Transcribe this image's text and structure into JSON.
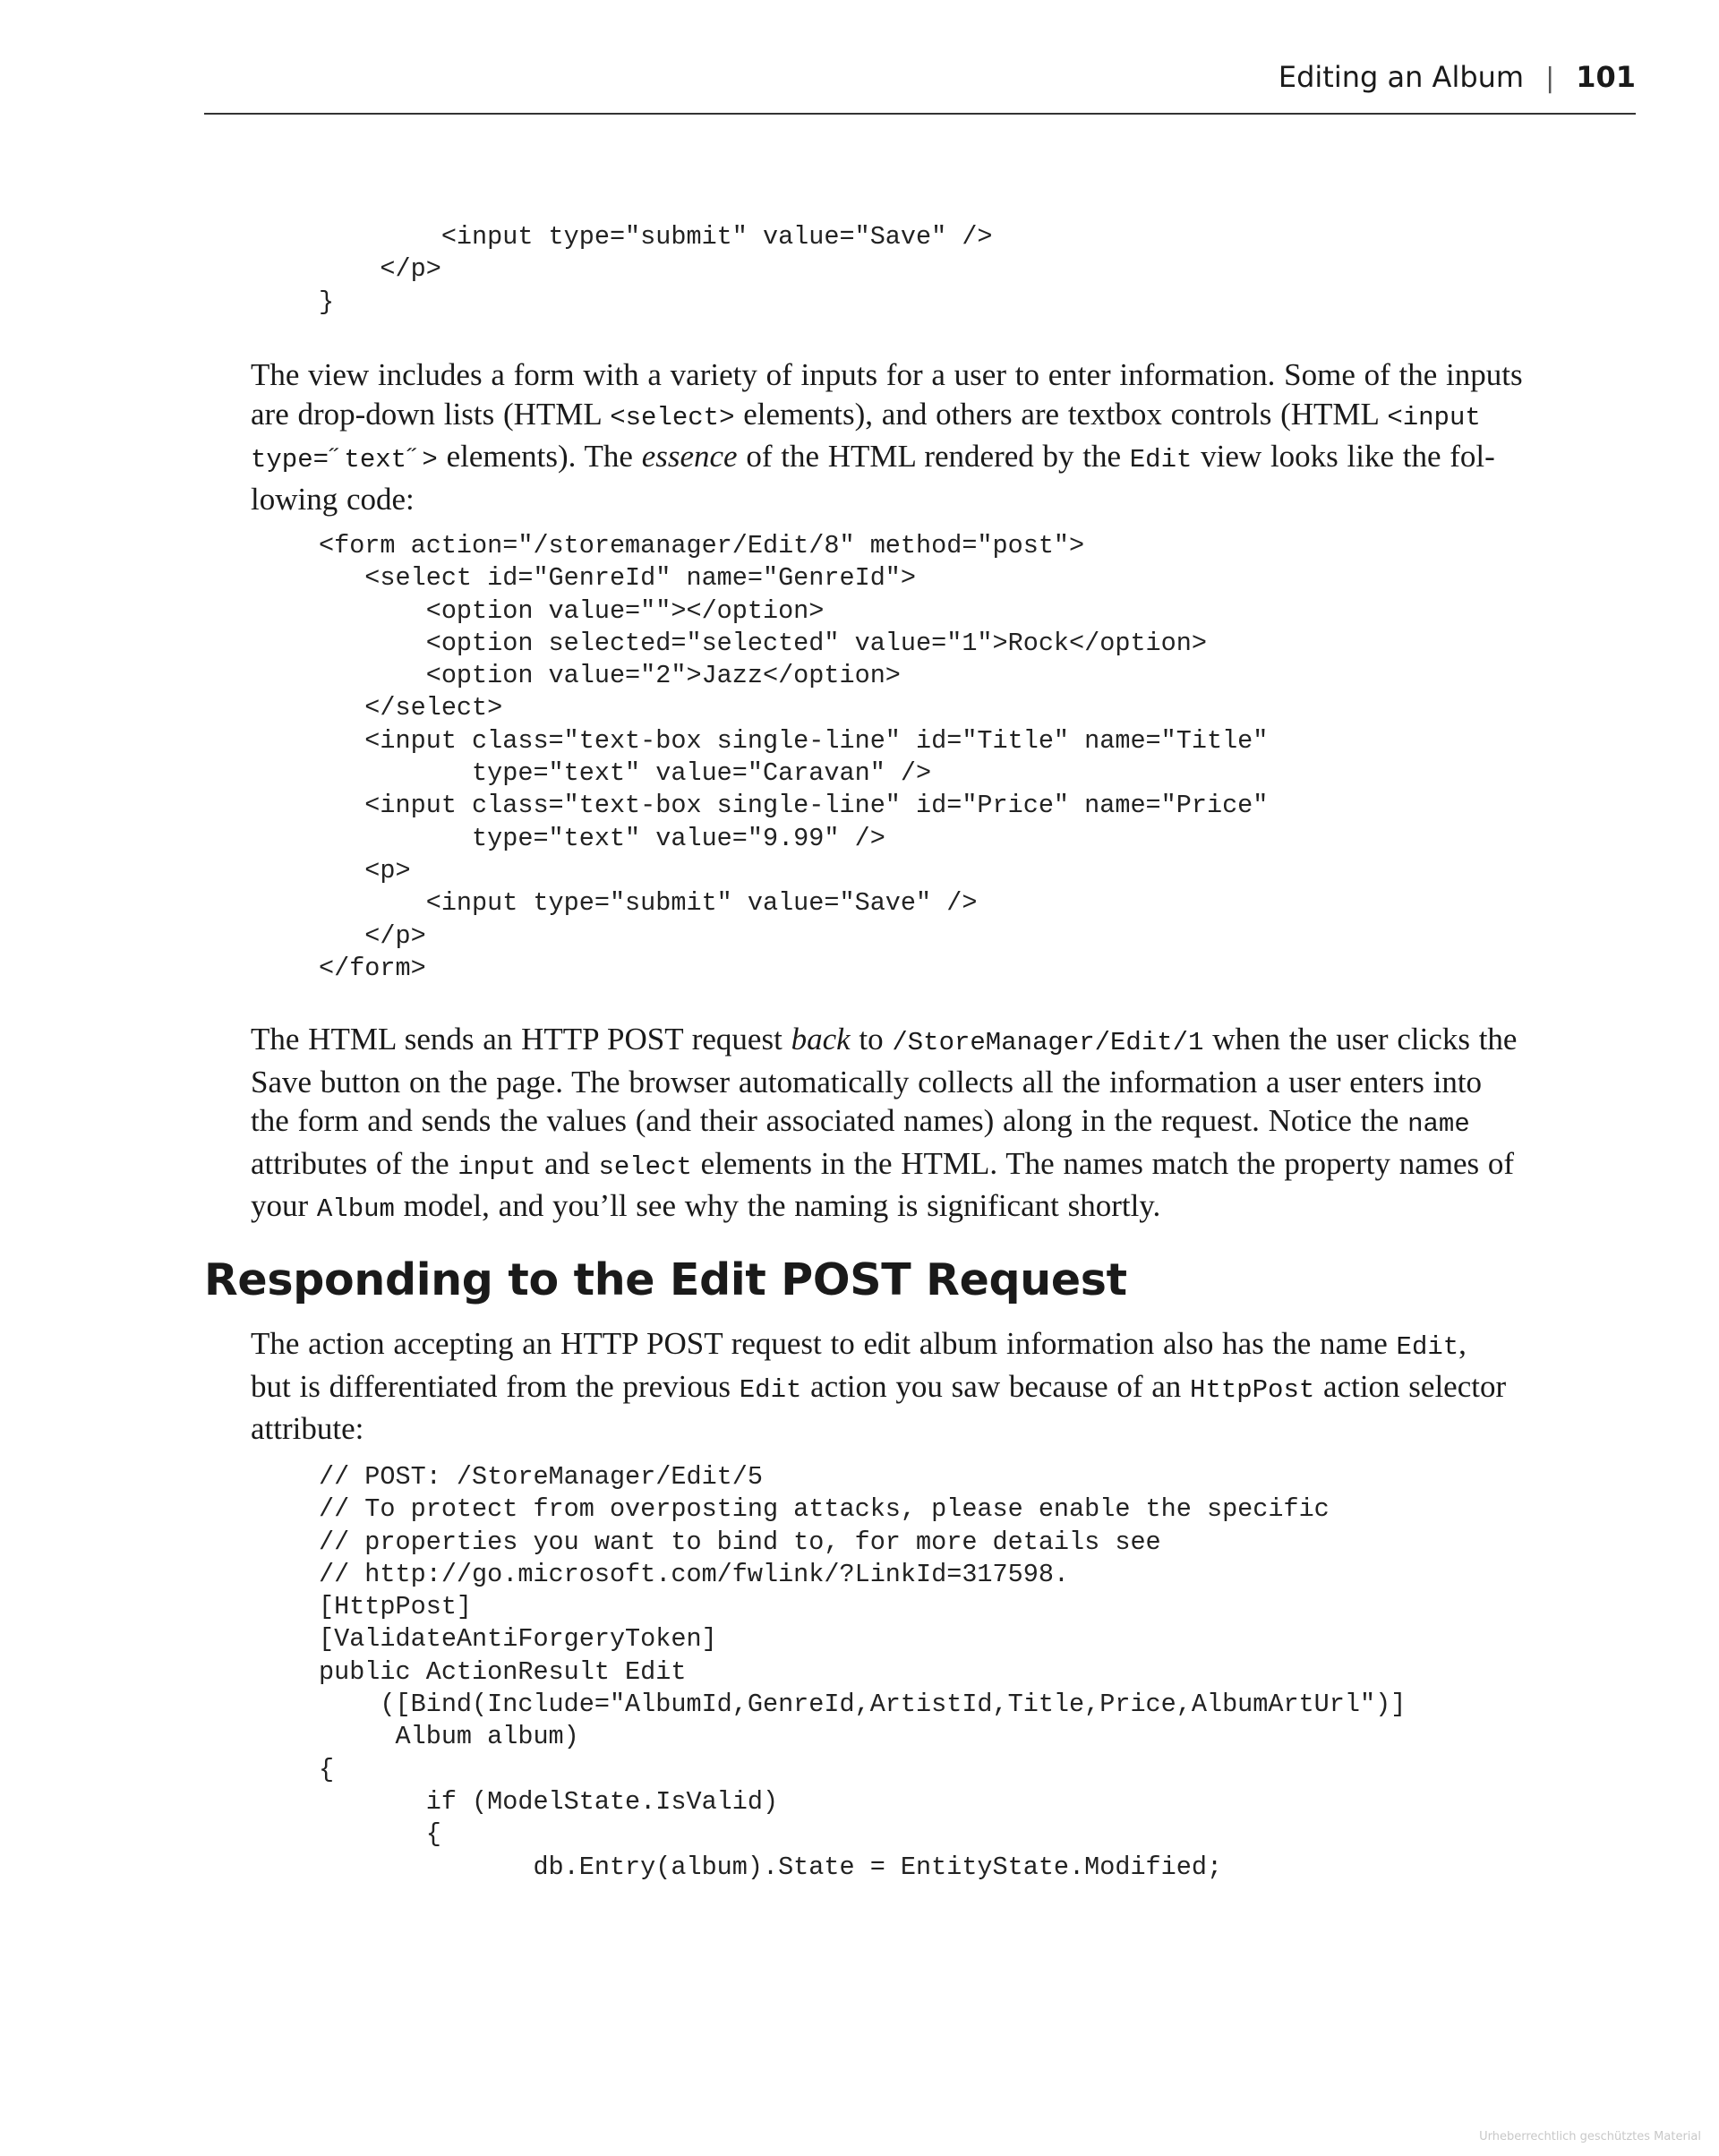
{
  "header": {
    "chapter_title": "Editing an Album",
    "separator": "|",
    "page_number": "101"
  },
  "code_top": [
    "        <input type=\"submit\" value=\"Save\" />",
    "    </p>",
    "}"
  ],
  "para1": {
    "l1": "The view includes a form with a variety of inputs for a user to enter information. Some of the inputs",
    "l2a": "are drop-down lists (HTML ",
    "l2b": "<select>",
    "l2c": " elements), and others are textbox controls (HTML ",
    "l2d": "<input",
    "l3a": "type=˝text˝>",
    "l3b": " elements). The ",
    "l3c": "essence",
    "l3d": " of the HTML rendered by the ",
    "l3e": "Edit",
    "l3f": " view looks like the fol-",
    "l4": "lowing code:"
  },
  "code_form": [
    "<form action=\"/storemanager/Edit/8\" method=\"post\">",
    "   <select id=\"GenreId\" name=\"GenreId\">",
    "       <option value=\"\"></option>",
    "       <option selected=\"selected\" value=\"1\">Rock</option>",
    "       <option value=\"2\">Jazz</option>",
    "   </select>",
    "   <input class=\"text-box single-line\" id=\"Title\" name=\"Title\"",
    "          type=\"text\" value=\"Caravan\" />",
    "   <input class=\"text-box single-line\" id=\"Price\" name=\"Price\"",
    "          type=\"text\" value=\"9.99\" />",
    "   <p>",
    "       <input type=\"submit\" value=\"Save\" />",
    "   </p>",
    "</form>"
  ],
  "para2": {
    "l1a": "The HTML sends an HTTP POST request ",
    "l1b": "back",
    "l1c": " to ",
    "l1d": "/StoreManager/Edit/1",
    "l1e": " when the user clicks the",
    "l2": "Save button on the page. The browser automatically collects all the information a user enters into",
    "l3a": "the form and sends the values (and their associated names) along in the request. Notice the ",
    "l3b": "name",
    "l4a": "attributes of the ",
    "l4b": "input",
    "l4c": " and ",
    "l4d": "select",
    "l4e": " elements in the HTML. The names match the property names of",
    "l5a": "your ",
    "l5b": "Album",
    "l5c": " model, and you’ll see why the naming is significant shortly."
  },
  "section_heading": "Responding to the Edit POST Request",
  "para3": {
    "l1a": "The action accepting an HTTP POST request to edit album information also has the name ",
    "l1b": "Edit",
    "l1c": ",",
    "l2a": "but is differentiated from the previous ",
    "l2b": "Edit",
    "l2c": " action you saw because of an ",
    "l2d": "HttpPost",
    "l2e": " action selector",
    "l3": "attribute:"
  },
  "code_action": [
    "// POST: /StoreManager/Edit/5",
    "// To protect from overposting attacks, please enable the specific",
    "// properties you want to bind to, for more details see",
    "// http://go.microsoft.com/fwlink/?LinkId=317598.",
    "[HttpPost]",
    "[ValidateAntiForgeryToken]",
    "public ActionResult Edit",
    "    ([Bind(Include=\"AlbumId,GenreId,ArtistId,Title,Price,AlbumArtUrl\")]",
    "     Album album)",
    "{",
    "       if (ModelState.IsValid)",
    "       {",
    "              db.Entry(album).State = EntityState.Modified;"
  ],
  "watermark": "Urheberrechtlich geschütztes Material"
}
